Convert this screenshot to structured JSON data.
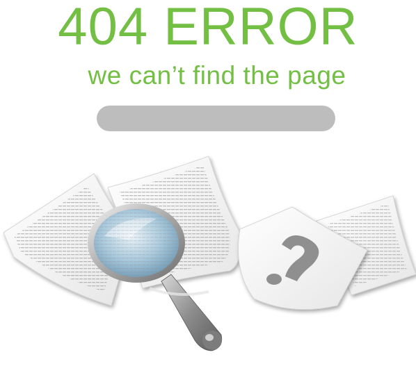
{
  "error": {
    "title": "404 ERROR",
    "subtitle": "we can’t find the page"
  },
  "search": {
    "value": "",
    "placeholder": ""
  },
  "illustration": {
    "icons": [
      "document-icon",
      "magnifying-glass-icon",
      "question-mark-icon"
    ],
    "question_glyph": "?"
  },
  "colors": {
    "accent": "#72bf44",
    "search_bar": "#bdbdbd",
    "paper": "#fbfbfb",
    "paper_shadow": "#d9d9d9",
    "text_lines": "#8a8a8a",
    "lens_blue": "#9fc3d8",
    "metal": "#9a9a9a"
  }
}
